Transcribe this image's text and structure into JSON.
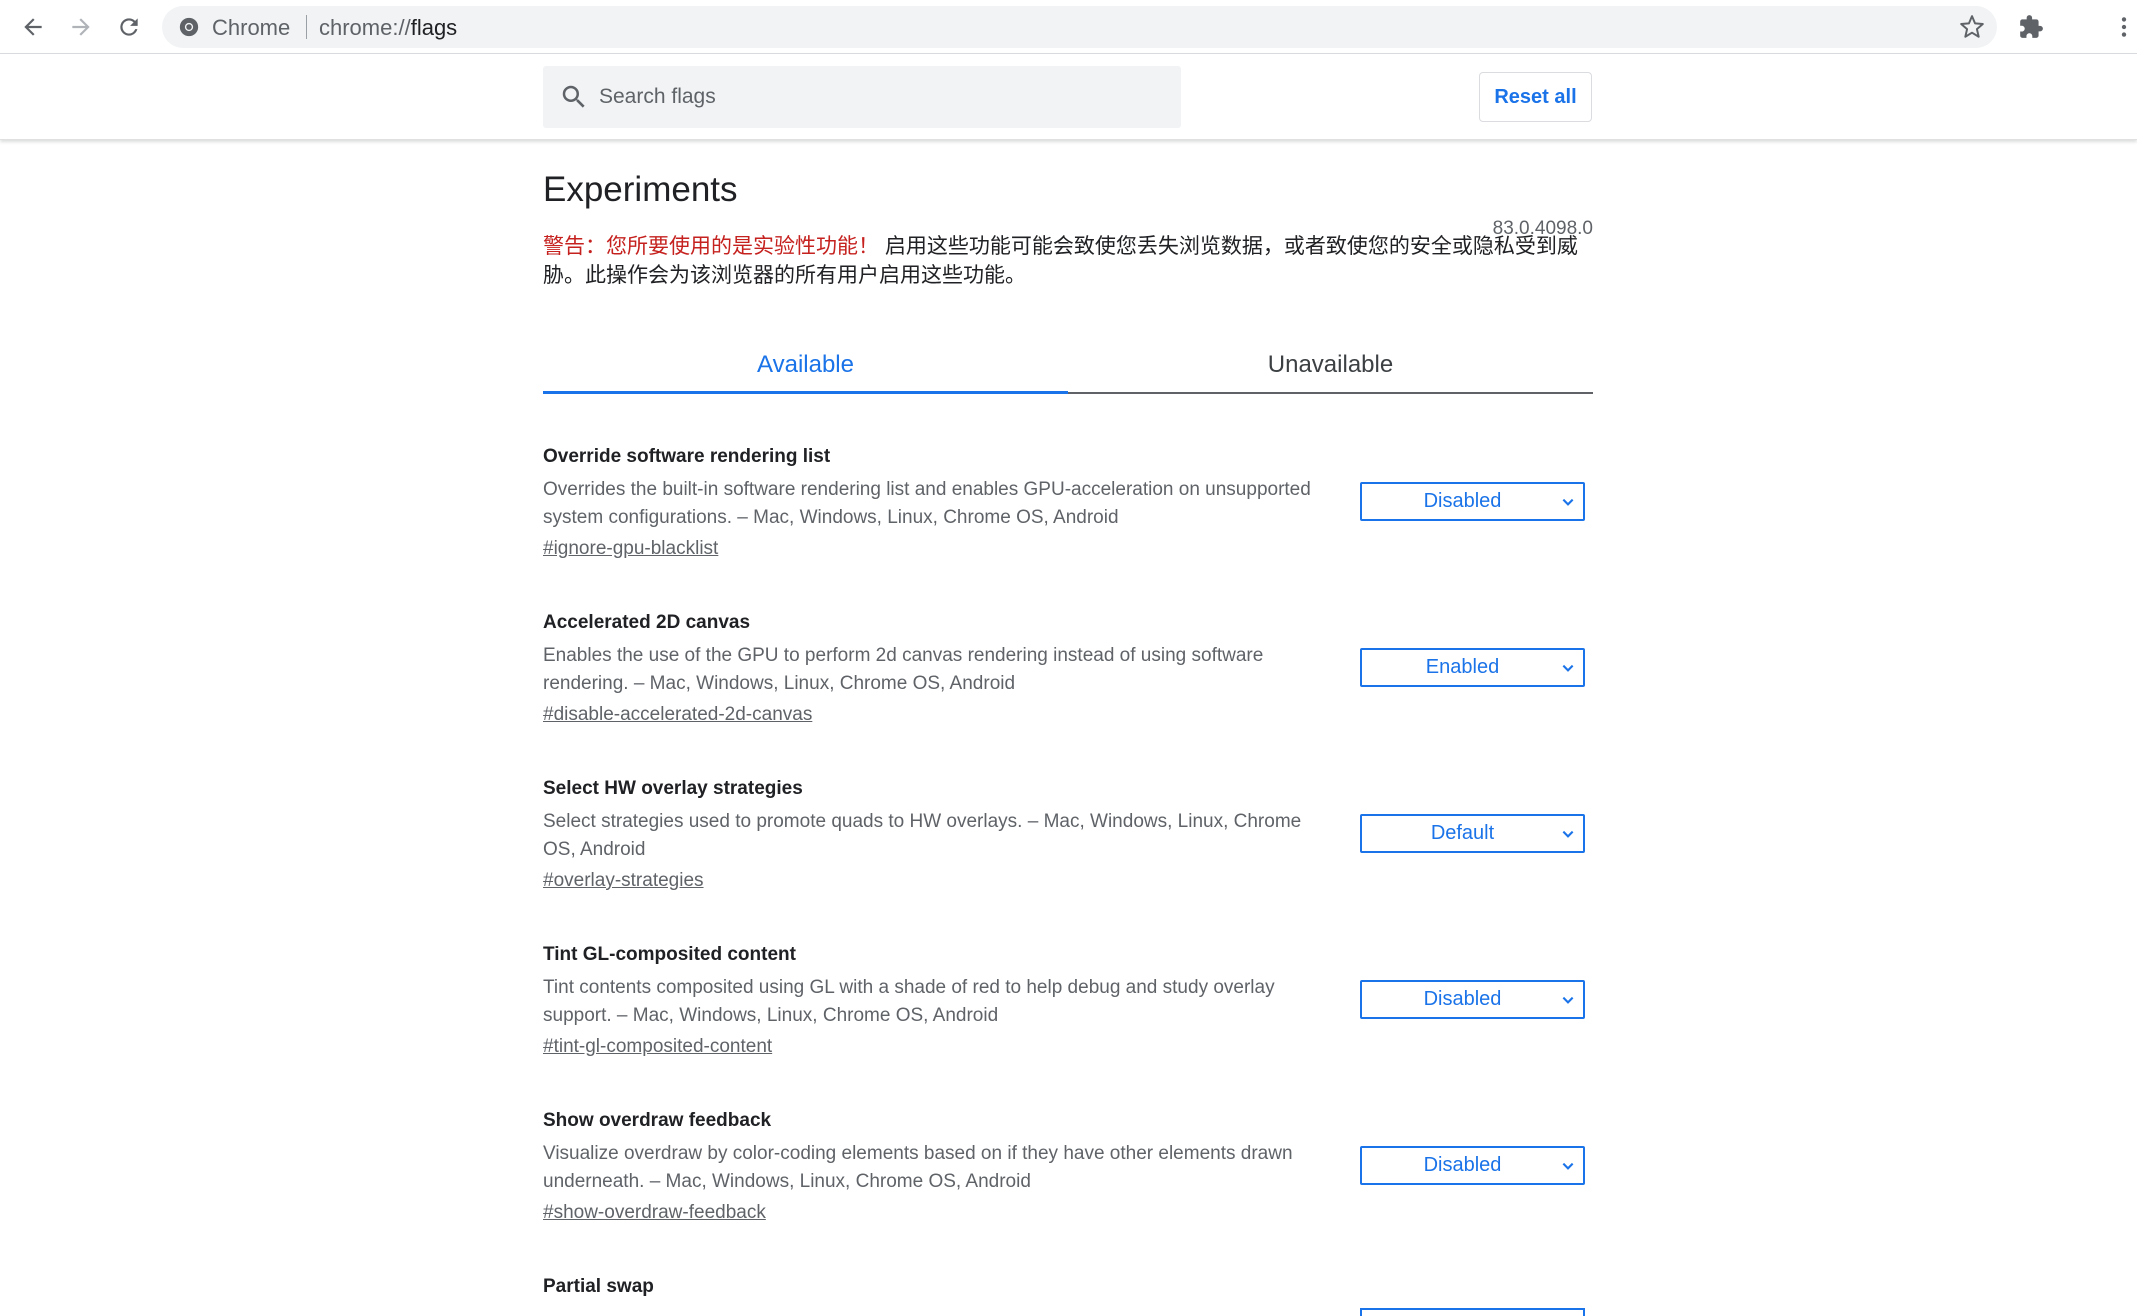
{
  "browser": {
    "site_name": "Chrome",
    "url_prefix": "chrome://",
    "url_host": "flags"
  },
  "header": {
    "search_placeholder": "Search flags",
    "reset_label": "Reset all"
  },
  "page": {
    "title": "Experiments",
    "version": "83.0.4098.0",
    "warning_prefix": "警告：您所要使用的是实验性功能！",
    "warning_text": "启用这些功能可能会致使您丢失浏览数据，或者致使您的安全或隐私受到威胁。此操作会为该浏览器的所有用户启用这些功能。"
  },
  "tabs": {
    "available": "Available",
    "unavailable": "Unavailable"
  },
  "flags": [
    {
      "name": "Override software rendering list",
      "desc": "Overrides the built-in software rendering list and enables GPU-acceleration on unsupported system configurations. – Mac, Windows, Linux, Chrome OS, Android",
      "link": "#ignore-gpu-blacklist",
      "value": "Disabled"
    },
    {
      "name": "Accelerated 2D canvas",
      "desc": "Enables the use of the GPU to perform 2d canvas rendering instead of using software rendering. – Mac, Windows, Linux, Chrome OS, Android",
      "link": "#disable-accelerated-2d-canvas",
      "value": "Enabled"
    },
    {
      "name": "Select HW overlay strategies",
      "desc": "Select strategies used to promote quads to HW overlays. – Mac, Windows, Linux, Chrome OS, Android",
      "link": "#overlay-strategies",
      "value": "Default"
    },
    {
      "name": "Tint GL-composited content",
      "desc": "Tint contents composited using GL with a shade of red to help debug and study overlay support. – Mac, Windows, Linux, Chrome OS, Android",
      "link": "#tint-gl-composited-content",
      "value": "Disabled"
    },
    {
      "name": "Show overdraw feedback",
      "desc": "Visualize overdraw by color-coding elements based on if they have other elements drawn underneath. – Mac, Windows, Linux, Chrome OS, Android",
      "link": "#show-overdraw-feedback",
      "value": "Disabled"
    },
    {
      "name": "Partial swap"
    }
  ],
  "icons": {
    "back": "back-arrow-icon",
    "forward": "forward-arrow-icon",
    "reload": "reload-icon",
    "site": "chrome-logo-icon",
    "bookmark": "star-icon",
    "extensions": "puzzle-icon",
    "menu": "kebab-menu-icon",
    "search": "search-icon",
    "dropdown": "chevron-down-icon"
  },
  "colors": {
    "accent": "#1a73e8",
    "warning": "#c5221f",
    "text_secondary": "#5f6368"
  }
}
